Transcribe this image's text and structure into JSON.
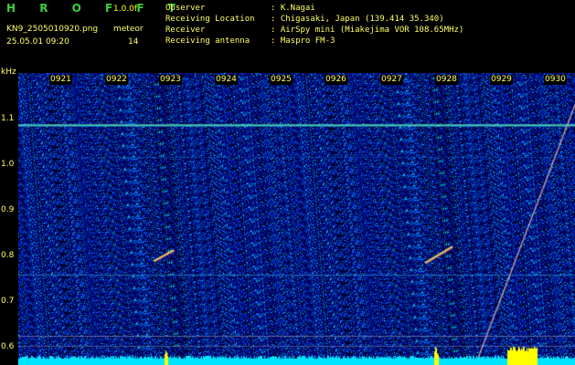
{
  "header": {
    "logo": "H R O F F T",
    "version": "1.0.0f",
    "filename": "KN9_2505010920.png",
    "mode": "meteor",
    "datetime": "25.05.01 09:20",
    "count": "14",
    "info_keys": [
      "Observer",
      "Receiving Location",
      "Receiver",
      "Receiving antenna"
    ],
    "info_values": [
      ": K.Nagai",
      ": Chigasaki, Japan (139.414 35.340)",
      ": AirSpy mini (Miakejima VOR 108.65MHz)",
      ": Maspro FM-3"
    ]
  },
  "axis": {
    "unit": "kHz",
    "y_labels": [
      "1.1",
      "1.0",
      "0.9",
      "0.8",
      "0.7",
      "0.6"
    ],
    "time_labels": [
      "0921",
      "0922",
      "0923",
      "0924",
      "0925",
      "0926",
      "0927",
      "0928",
      "0929",
      "0930"
    ]
  },
  "colors": {
    "background": "#000000",
    "noise_base": "#0a0f8a",
    "bottom_level": "#00e5ff",
    "spike": "#ffff00",
    "carrier": "#3ed8c8"
  }
}
